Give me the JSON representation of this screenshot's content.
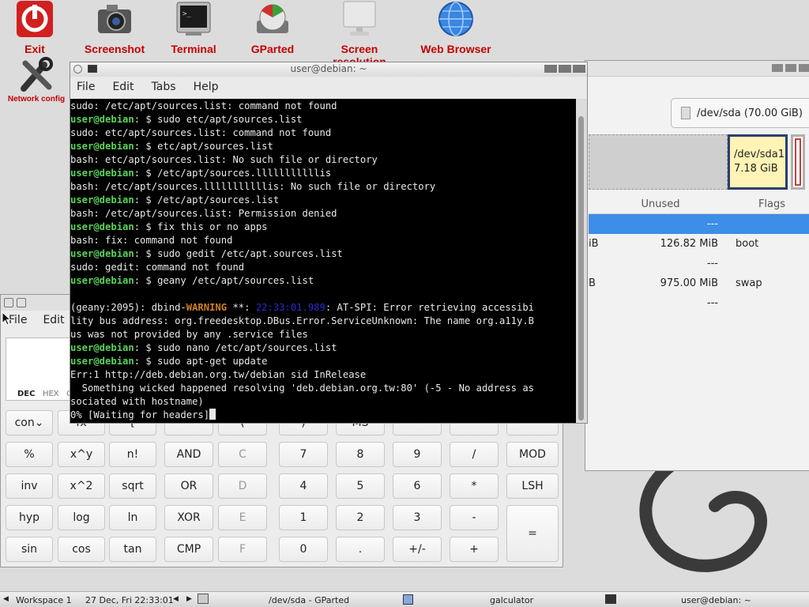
{
  "desktop": {
    "icons": [
      {
        "label": "Exit",
        "icon": "power-icon"
      },
      {
        "label": "Screenshot",
        "icon": "camera-icon"
      },
      {
        "label": "Terminal",
        "icon": "terminal-icon"
      },
      {
        "label": "GParted",
        "icon": "disk-icon"
      },
      {
        "label": "Screen resolution",
        "icon": "monitor-icon"
      },
      {
        "label": "Web Browser",
        "icon": "globe-icon"
      }
    ],
    "network_config": {
      "label": "Network config",
      "icon": "tools-icon"
    },
    "accent": "#c40000"
  },
  "terminal": {
    "title": "user@debian: ~",
    "menu": [
      "File",
      "Edit",
      "Tabs",
      "Help"
    ],
    "prompt_user": "user@debian",
    "prompt_dir": ": $ ",
    "lines": [
      {
        "text": "sudo: /etc/apt/sources.list: command not found"
      },
      {
        "cmd": "sudo etc/apt/sources.list"
      },
      {
        "text": "sudo: etc/apt/sources.list: command not found"
      },
      {
        "cmd": "etc/apt/sources.list"
      },
      {
        "text": "bash: etc/apt/sources.list: No such file or directory"
      },
      {
        "cmd": "/etc/apt/sources.lllllllllllis"
      },
      {
        "text": "bash: /etc/apt/sources.lllllllllllis: No such file or directory"
      },
      {
        "cmd": "/etc/apt/sources.list"
      },
      {
        "text": "bash: /etc/apt/sources.list: Permission denied"
      },
      {
        "cmd": "fix this or no apps"
      },
      {
        "text": "bash: fix: command not found"
      },
      {
        "cmd": "sudo gedit /etc/apt.sources.list"
      },
      {
        "text": "sudo: gedit: command not found"
      },
      {
        "cmd": "geany /etc/apt/sources.list"
      },
      {
        "text": ""
      },
      {
        "warn_pre": "(geany:2095): dbind-",
        "warn": "WARNING",
        "warn_mid": " **: ",
        "warn_ts": "22:33:01.989",
        "warn_post": ": AT-SPI: Error retrieving accessibi"
      },
      {
        "text": "lity bus address: org.freedesktop.DBus.Error.ServiceUnknown: The name org.a11y.B"
      },
      {
        "text": "us was not provided by any .service files"
      },
      {
        "cmd": "sudo nano /etc/apt/sources.list"
      },
      {
        "cmd": "sudo apt-get update"
      },
      {
        "text": "Err:1 http://deb.debian.org.tw/debian sid InRelease"
      },
      {
        "text": "  Something wicked happened resolving 'deb.debian.org.tw:80' (-5 - No address as"
      },
      {
        "text": "sociated with hostname)"
      },
      {
        "text": "0% [Waiting for headers]",
        "cursor": true
      }
    ]
  },
  "gparted": {
    "device": "/dev/sda (70.00 GiB)",
    "partition_label": "/dev/sda1",
    "partition_size": "7.18 GiB",
    "columns": [
      "Unused",
      "Flags"
    ],
    "rows": [
      {
        "pre": "",
        "unused": "---",
        "flags": "",
        "selected": true
      },
      {
        "pre": "iB",
        "unused": "126.82 MiB",
        "flags": "boot"
      },
      {
        "pre": "",
        "unused": "---",
        "flags": ""
      },
      {
        "pre": "B",
        "unused": "975.00 MiB",
        "flags": "swap"
      },
      {
        "pre": "",
        "unused": "---",
        "flags": ""
      }
    ],
    "colors": {
      "selected_row": "#3d8ee6",
      "partition_border": "#2a3f70",
      "partition_fill": "#fff4b5"
    }
  },
  "calculator": {
    "menu": [
      "File",
      "Edit"
    ],
    "modes": [
      "DEC",
      "HEX",
      "OC"
    ],
    "rows": [
      [
        "con",
        "fx",
        "[",
        "",
        "(",
        ")",
        "MS",
        "",
        "",
        ""
      ],
      [
        "%",
        "x^y",
        "n!",
        "AND",
        "C",
        "7",
        "8",
        "9",
        "/",
        "MOD"
      ],
      [
        "inv",
        "x^2",
        "sqrt",
        "OR",
        "D",
        "4",
        "5",
        "6",
        "*",
        "LSH"
      ],
      [
        "hyp",
        "log",
        "ln",
        "XOR",
        "E",
        "1",
        "2",
        "3",
        "-",
        "="
      ],
      [
        "sin",
        "cos",
        "tan",
        "CMP",
        "F",
        "0",
        ".",
        "+/-",
        "+",
        ""
      ]
    ]
  },
  "taskbar": {
    "workspace": "Workspace 1",
    "datetime": "27 Dec, Fri 22:33:01",
    "tasks": [
      "/dev/sda - GParted",
      "galculator",
      "user@debian: ~"
    ]
  }
}
